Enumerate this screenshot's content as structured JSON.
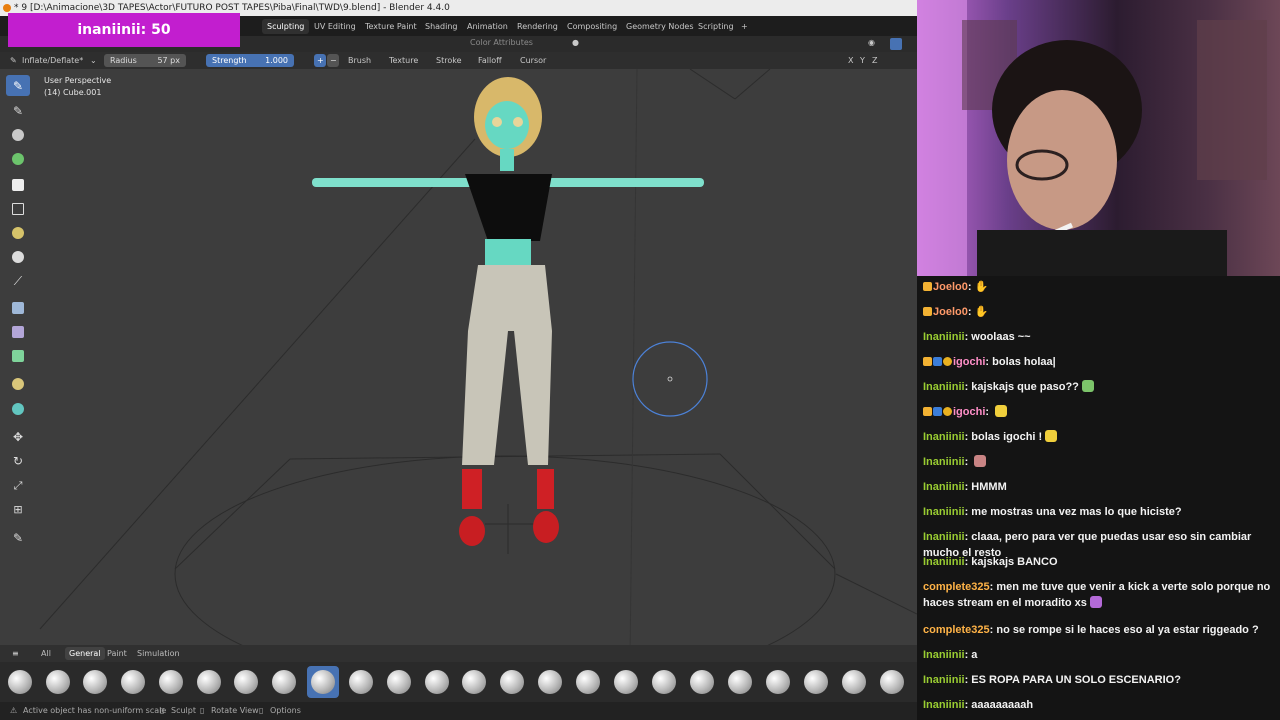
{
  "overlay": {
    "sub_badge": "inaniinii: 50"
  },
  "blender": {
    "title_bar": "* 9 [D:\\Animacione\\3D TAPES\\Actor\\FUTURO POST TAPES\\Piba\\Final\\TWD\\9.blend] - Blender 4.4.0",
    "workspace_tabs": [
      "Sculpting",
      "UV Editing",
      "Texture Paint",
      "Shading",
      "Animation",
      "Rendering",
      "Compositing",
      "Geometry Nodes",
      "Scripting"
    ],
    "active_workspace": "Sculpting",
    "add_workspace_label": "+",
    "header": {
      "color_attributes_label": "Color Attributes"
    },
    "tool_settings": {
      "brush_name": "Inflate/Deflate*",
      "radius_label": "Radius",
      "radius_value": "57 px",
      "strength_label": "Strength",
      "strength_value": "1.000",
      "plus": "+",
      "minus": "−",
      "menus": [
        "Brush",
        "Texture",
        "Stroke",
        "Falloff",
        "Cursor"
      ],
      "axes": [
        "X",
        "Y",
        "Z"
      ]
    },
    "viewport": {
      "perspective_label": "User Perspective",
      "object_label": "(14) Cube.001"
    },
    "brush_tabs": [
      "All",
      "General",
      "Paint",
      "Simulation"
    ],
    "active_brush_tab": "General",
    "status_bar": {
      "warning": "Active object has non-uniform scale",
      "sculpt": "Sculpt",
      "rotate": "Rotate View",
      "options": "Options"
    },
    "colors": {
      "accent": "#4772b3",
      "viewport_bg": "#3d3d3d",
      "skin": "#7fe0cc"
    }
  },
  "chat": {
    "messages": [
      {
        "user": "Joelo0",
        "color": "#ff7f50",
        "badges": [
          "crown"
        ],
        "text": "",
        "emote": "hands"
      },
      {
        "user": "Joelo0",
        "color": "#ff7f50",
        "badges": [
          "crown"
        ],
        "text": "",
        "emote": "hands"
      },
      {
        "user": "Inaniinii",
        "color": "#9acd32",
        "badges": [],
        "text": "woolaas ~~",
        "emote": ""
      },
      {
        "user": "igochi",
        "color": "#ff69b4",
        "badges": [
          "crown",
          "ie",
          "circle"
        ],
        "text": "bolas holaa|",
        "emote": ""
      },
      {
        "user": "Inaniinii",
        "color": "#9acd32",
        "badges": [],
        "text": "kajskajs que paso??",
        "emote": "face"
      },
      {
        "user": "igochi",
        "color": "#ff69b4",
        "badges": [
          "crown",
          "ie",
          "circle"
        ],
        "text": "",
        "emote": "face-yellow"
      },
      {
        "user": "Inaniinii",
        "color": "#9acd32",
        "badges": [],
        "text": "bolas igochi !",
        "emote": "face-yellow"
      },
      {
        "user": "Inaniinii",
        "color": "#9acd32",
        "badges": [],
        "text": "",
        "emote": "face-pink"
      },
      {
        "user": "Inaniinii",
        "color": "#9acd32",
        "badges": [],
        "text": "HMMM",
        "emote": ""
      },
      {
        "user": "Inaniinii",
        "color": "#9acd32",
        "badges": [],
        "text": "me mostras una vez mas lo que hiciste?",
        "emote": ""
      },
      {
        "user": "Inaniinii",
        "color": "#9acd32",
        "badges": [],
        "text": "claaa, pero para ver que puedas usar eso sin cambiar mucho el resto",
        "emote": ""
      },
      {
        "user": "Inaniinii",
        "color": "#9acd32",
        "badges": [],
        "text": "kajskajs BANCO",
        "emote": ""
      },
      {
        "user": "complete325",
        "color": "#ffb347",
        "badges": [],
        "text": "men me tuve que venir a kick a verte solo porque no haces stream en el moradito xs",
        "emote": "face-purple"
      },
      {
        "user": "complete325",
        "color": "#ffb347",
        "badges": [],
        "text": "no se rompe si le haces eso al ya estar riggeado ?",
        "emote": ""
      },
      {
        "user": "Inaniinii",
        "color": "#9acd32",
        "badges": [],
        "text": "a",
        "emote": ""
      },
      {
        "user": "Inaniinii",
        "color": "#9acd32",
        "badges": [],
        "text": "ES ROPA PARA UN SOLO ESCENARIO?",
        "emote": ""
      },
      {
        "user": "Inaniinii",
        "color": "#9acd32",
        "badges": [],
        "text": "aaaaaaaaah",
        "emote": ""
      }
    ]
  }
}
